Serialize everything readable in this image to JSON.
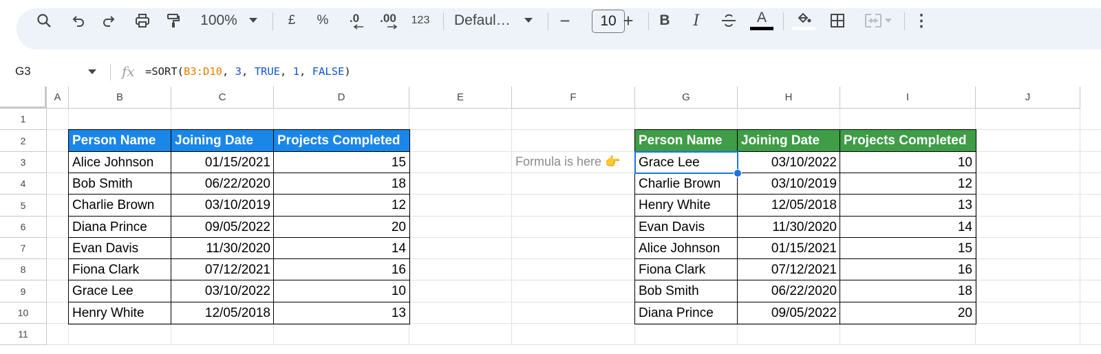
{
  "toolbar": {
    "zoom": "100%",
    "currency": "£",
    "percent": "%",
    "decrease_decimal": ".0",
    "increase_decimal": ".00",
    "number_format": "123",
    "font_name": "Defaul…",
    "font_size": "10",
    "minus": "−",
    "plus": "+",
    "bold": "B",
    "italic": "I",
    "text_color_letter": "A",
    "more": "⋮"
  },
  "formula_bar": {
    "name_box": "G3",
    "fx": "fx",
    "formula_prefix": "=SORT(",
    "formula_range": "B3:D10",
    "formula_sep1": ", ",
    "formula_arg1": "3",
    "formula_sep2": ", ",
    "formula_arg2": "TRUE",
    "formula_sep3": ", ",
    "formula_arg3": "1",
    "formula_sep4": ", ",
    "formula_arg4": "FALSE",
    "formula_suffix": ")"
  },
  "columns": [
    "A",
    "B",
    "C",
    "D",
    "E",
    "F",
    "G",
    "H",
    "I",
    "J"
  ],
  "rows": [
    "1",
    "2",
    "3",
    "4",
    "5",
    "6",
    "7",
    "8",
    "9",
    "10",
    "11"
  ],
  "source_table": {
    "headers": [
      "Person Name",
      "Joining Date",
      "Projects Completed"
    ],
    "rows": [
      [
        "Alice Johnson",
        "01/15/2021",
        "15"
      ],
      [
        "Bob Smith",
        "06/22/2020",
        "18"
      ],
      [
        "Charlie Brown",
        "03/10/2019",
        "12"
      ],
      [
        "Diana Prince",
        "09/05/2022",
        "20"
      ],
      [
        "Evan Davis",
        "11/30/2020",
        "14"
      ],
      [
        "Fiona Clark",
        "07/12/2021",
        "16"
      ],
      [
        "Grace Lee",
        "03/10/2022",
        "10"
      ],
      [
        "Henry White",
        "12/05/2018",
        "13"
      ]
    ]
  },
  "note": "Formula is here 👉",
  "sorted_table": {
    "headers": [
      "Person Name",
      "Joining Date",
      "Projects Completed"
    ],
    "rows": [
      [
        "Grace Lee",
        "03/10/2022",
        "10"
      ],
      [
        "Charlie Brown",
        "03/10/2019",
        "12"
      ],
      [
        "Henry White",
        "12/05/2018",
        "13"
      ],
      [
        "Evan Davis",
        "11/30/2020",
        "14"
      ],
      [
        "Alice Johnson",
        "01/15/2021",
        "15"
      ],
      [
        "Fiona Clark",
        "07/12/2021",
        "16"
      ],
      [
        "Bob Smith",
        "06/22/2020",
        "18"
      ],
      [
        "Diana Prince",
        "09/05/2022",
        "20"
      ]
    ]
  },
  "colors": {
    "source_header": "#1a86e8",
    "sorted_header": "#3e9d46",
    "selection": "#1a73e8"
  }
}
